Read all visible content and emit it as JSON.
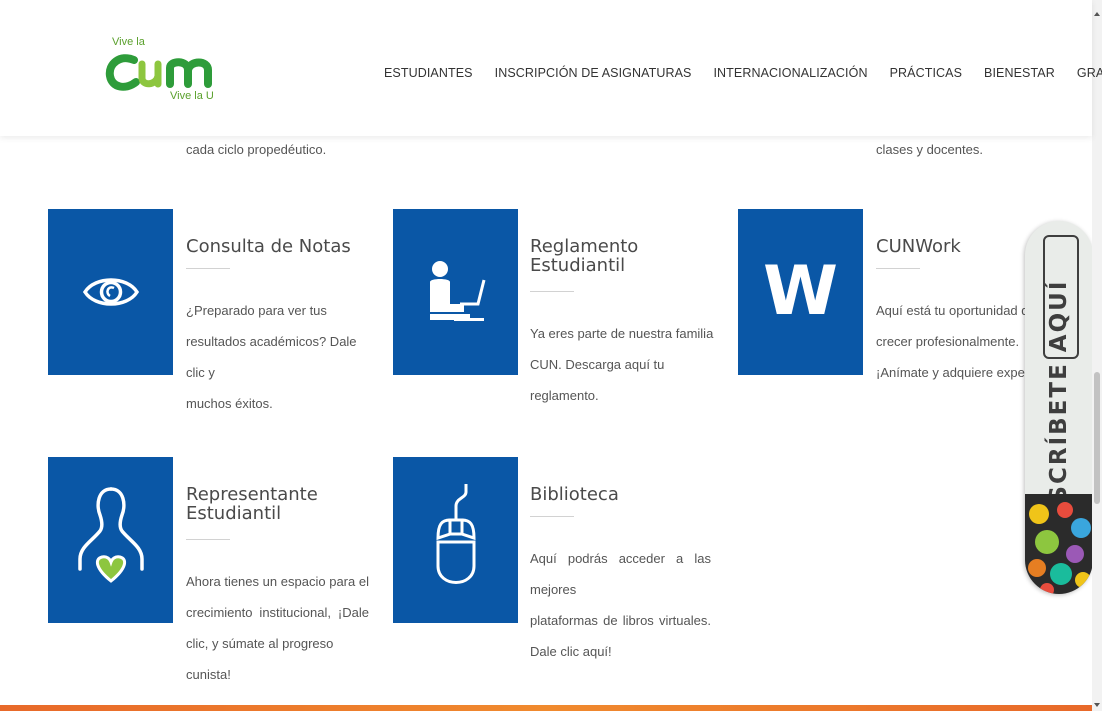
{
  "brand": {
    "tagline_top": "Vive la",
    "name": "CUN",
    "tagline_bottom": "Vive la U",
    "colors": {
      "green": "#2e9c3a",
      "lime": "#8dc63f",
      "blue": "#0a57a6",
      "orange": "#e8692a"
    }
  },
  "nav": {
    "items": [
      {
        "label": "ESTUDIANTES"
      },
      {
        "label": "INSCRIPCIÓN DE ASIGNATURAS"
      },
      {
        "label": "INTERNACIONALIZACIÓN"
      },
      {
        "label": "PRÁCTICAS"
      },
      {
        "label": "BIENESTAR"
      },
      {
        "label": "GRADOS"
      }
    ]
  },
  "fragments": {
    "left": "cada ciclo propedéutico.",
    "right": "clases y docentes."
  },
  "cards": [
    {
      "icon": "eye-icon",
      "title": "Consulta de Notas",
      "lines": [
        "¿Preparado para ver tus",
        "resultados académicos? Dale clic y",
        "muchos éxitos."
      ]
    },
    {
      "icon": "student-laptop-icon",
      "title_lines": [
        "Reglamento",
        "Estudiantil"
      ],
      "lines": [
        "Ya eres parte de nuestra familia",
        "CUN. Descarga aquí tu",
        "reglamento."
      ]
    },
    {
      "icon": "word-w-icon",
      "icon_text": "W",
      "title": "CUNWork",
      "lines": [
        "Aquí está tu oportunidad de",
        "crecer profesionalmente.",
        "¡Anímate y adquiere experie"
      ]
    },
    {
      "icon": "person-heart-icon",
      "title_lines": [
        "Representante",
        "Estudiantil"
      ],
      "lines": [
        "Ahora tienes un espacio para el",
        "crecimiento institucional, ¡Dale",
        "clic, y súmate al progreso cunista!"
      ]
    },
    {
      "icon": "mouse-icon",
      "title": "Biblioteca",
      "lines": [
        "Aquí podrás acceder a las mejores",
        "plataformas de libros virtuales.",
        "Dale clic aquí!"
      ]
    }
  ],
  "banner": {
    "label": "INSCRÍBETE AQUÍ"
  }
}
